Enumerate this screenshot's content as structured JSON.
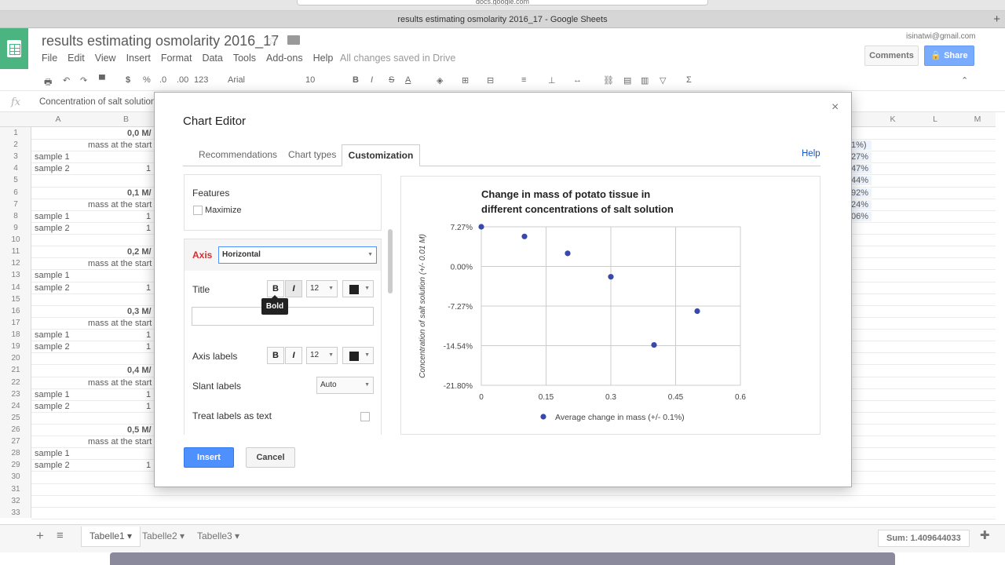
{
  "browser": {
    "window_title": "results estimating osmolarity 2016_17 - Google Sheets",
    "url": "docs.google.com"
  },
  "header": {
    "doc_title": "results estimating osmolarity 2016_17",
    "menu": [
      "File",
      "Edit",
      "View",
      "Insert",
      "Format",
      "Data",
      "Tools",
      "Add-ons",
      "Help"
    ],
    "save_status": "All changes saved in Drive",
    "account": "isinatwi@gmail.com",
    "comments_label": "Comments",
    "share_label": "Share"
  },
  "toolbar": {
    "currency": "$",
    "percent": "%",
    "dec_less": ".0",
    "dec_more": ".00",
    "format_more": "123",
    "font": "Arial",
    "font_size": "10",
    "bold": "B",
    "italic": "I",
    "strike": "S",
    "text_color": "A",
    "sum": "Σ"
  },
  "formula_bar": {
    "fx": "fx",
    "value": "Concentration of salt solution"
  },
  "grid": {
    "columns": [
      "A",
      "B",
      "K",
      "L",
      "M"
    ],
    "rows": [
      "1",
      "2",
      "3",
      "4",
      "5",
      "6",
      "7",
      "8",
      "9",
      "10",
      "11",
      "12",
      "13",
      "14",
      "15",
      "16",
      "17",
      "18",
      "19",
      "20",
      "21",
      "22",
      "23",
      "24",
      "25",
      "26",
      "27",
      "28",
      "29",
      "30",
      "31",
      "32",
      "33"
    ],
    "col_a": {
      "3": "sample 1",
      "4": "sample 2",
      "8": "sample 1",
      "9": "sample 2",
      "13": "sample 1",
      "14": "sample 2",
      "18": "sample 1",
      "19": "sample 2",
      "23": "sample 1",
      "24": "sample 2",
      "28": "sample 1",
      "29": "sample 2"
    },
    "col_b": {
      "1": "0,0 M/",
      "2": "mass at the start",
      "4": "1",
      "6": "0,1 M/",
      "7": "mass at the start",
      "8": "1",
      "9": "1",
      "11": "0,2 M/",
      "12": "mass at the start",
      "14": "1",
      "16": "0,3 M/",
      "17": "mass at the start",
      "18": "1",
      "19": "1",
      "21": "0,4 M/",
      "22": "mass at the start",
      "23": "1",
      "24": "1",
      "26": "0,5 M/",
      "27": "mass at the start",
      "29": "1"
    },
    "col_j": {
      "2": "1%)",
      "3": "27%",
      "4": "47%",
      "5": "44%",
      "6": "92%",
      "7": "24%",
      "8": "06%"
    }
  },
  "sheets": {
    "tabs": [
      "Tabelle1",
      "Tabelle2",
      "Tabelle3"
    ],
    "add": "+",
    "list": "≡",
    "sum_label": "Sum: 1.409644033"
  },
  "dialog": {
    "title": "Chart Editor",
    "close": "×",
    "tabs": [
      "Recommendations",
      "Chart types",
      "Customization"
    ],
    "active_tab": "Customization",
    "help": "Help",
    "features_label": "Features",
    "maximize_label": "Maximize",
    "axis_label": "Axis",
    "axis_value": "Horizontal",
    "title_label": "Title",
    "axis_labels_label": "Axis labels",
    "slant_labels_label": "Slant labels",
    "slant_value": "Auto",
    "treat_labels_label": "Treat labels as text",
    "bold_btn": "B",
    "italic_btn": "I",
    "size_value": "12",
    "tooltip": "Bold",
    "insert_label": "Insert",
    "cancel_label": "Cancel"
  },
  "chart_data": {
    "type": "scatter",
    "title": "Change in mass of potato tissue in different concentrations of salt solution",
    "ylabel": "Concentration of salt solution (+/- 0.01 M)",
    "xlabel": "",
    "x_ticks": [
      "0",
      "0.15",
      "0.3",
      "0.45",
      "0.6"
    ],
    "y_ticks": [
      "7.27%",
      "0.00%",
      "-7.27%",
      "-14.54%",
      "-21.80%"
    ],
    "xlim": [
      0,
      0.6
    ],
    "ylim": [
      -21.8,
      7.27
    ],
    "series": [
      {
        "name": "Average change in mass (+/- 0.1%)",
        "color": "#3949ab",
        "x": [
          0,
          0.1,
          0.2,
          0.3,
          0.4,
          0.5
        ],
        "y": [
          7.27,
          5.5,
          2.4,
          -1.9,
          -14.4,
          -8.2
        ]
      }
    ],
    "legend": "bottom",
    "grid": true
  }
}
